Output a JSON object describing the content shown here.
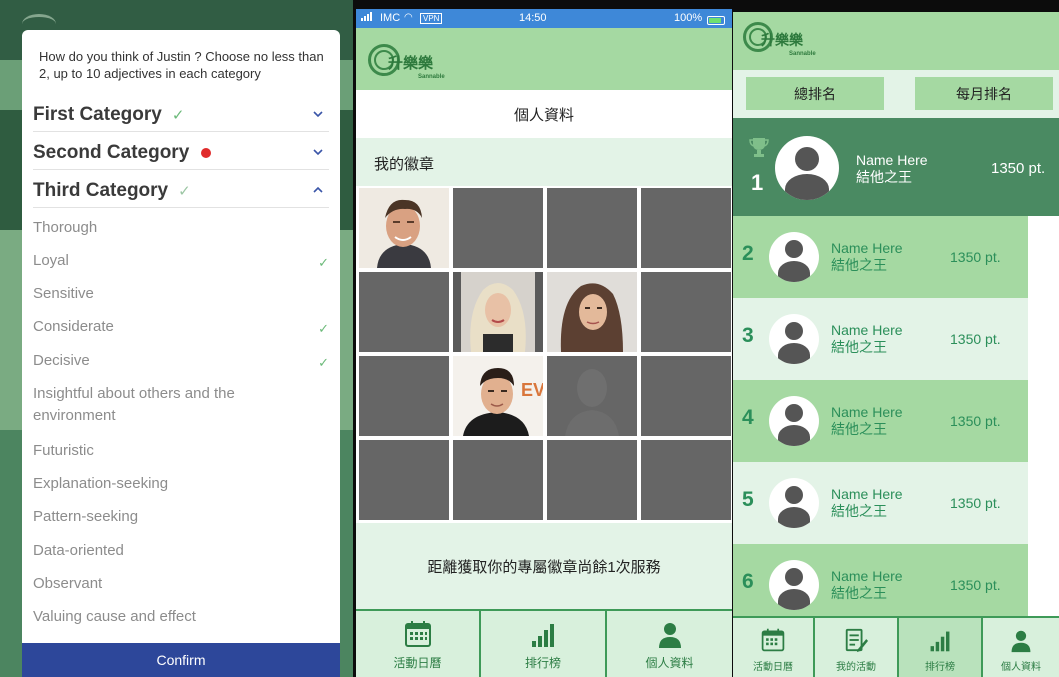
{
  "panel1": {
    "question": "How do you think of Justin ? Choose no less than 2, up to 10 adjectives in each category",
    "categories": [
      {
        "title": "First Category",
        "status": "check"
      },
      {
        "title": "Second Category",
        "status": "error"
      },
      {
        "title": "Third Category",
        "status": "check"
      }
    ],
    "adjectives": [
      {
        "label": "Thorough",
        "selected": false
      },
      {
        "label": "Loyal",
        "selected": true
      },
      {
        "label": "Sensitive",
        "selected": false
      },
      {
        "label": "Considerate",
        "selected": true
      },
      {
        "label": "Decisive",
        "selected": true
      },
      {
        "label": "Insightful about others and the environment",
        "selected": false
      },
      {
        "label": "Futuristic",
        "selected": false
      },
      {
        "label": "Explanation-seeking",
        "selected": false
      },
      {
        "label": "Pattern-seeking",
        "selected": false
      },
      {
        "label": "Data-oriented",
        "selected": false
      },
      {
        "label": "Observant",
        "selected": false
      },
      {
        "label": "Valuing cause and effect",
        "selected": false
      }
    ],
    "confirm_label": "Confirm",
    "check_glyph": "✓",
    "colors": {
      "accent_green": "#6cba7a",
      "error_red": "#e02b2b",
      "confirm_blue": "#2d479a"
    }
  },
  "panel2": {
    "status": {
      "carrier": "IMC",
      "vpn": "VPN",
      "time": "14:50",
      "battery": "100%"
    },
    "logo_text": "升樂樂",
    "logo_sub": "Sannable",
    "title": "個人資料",
    "badges_heading": "我的徽章",
    "message": "距離獲取你的專屬徽章尚餘1次服務",
    "nav": [
      {
        "label": "活動日曆",
        "icon": "calendar-icon"
      },
      {
        "label": "排行榜",
        "icon": "bar-chart-icon"
      },
      {
        "label": "個人資料",
        "icon": "person-icon"
      }
    ],
    "colors": {
      "header_green": "#a5d9a2",
      "light_green": "#e3f3e7",
      "status_blue": "#3e88d8"
    }
  },
  "panel3": {
    "logo_text": "升樂樂",
    "logo_sub": "Sannable",
    "tabs": [
      "總排名",
      "每月排名"
    ],
    "rankings": [
      {
        "rank": "1",
        "name": "Name Here",
        "title": "結他之王",
        "points": "1350 pt."
      },
      {
        "rank": "2",
        "name": "Name Here",
        "title": "結他之王",
        "points": "1350 pt."
      },
      {
        "rank": "3",
        "name": "Name Here",
        "title": "結他之王",
        "points": "1350 pt."
      },
      {
        "rank": "4",
        "name": "Name Here",
        "title": "結他之王",
        "points": "1350 pt."
      },
      {
        "rank": "5",
        "name": "Name Here",
        "title": "結他之王",
        "points": "1350 pt."
      },
      {
        "rank": "6",
        "name": "Name Here",
        "title": "結他之王",
        "points": "1350 pt."
      }
    ],
    "nav": [
      {
        "label": "活動日曆",
        "icon": "calendar-icon"
      },
      {
        "label": "我的活動",
        "icon": "edit-list-icon"
      },
      {
        "label": "排行榜",
        "icon": "bar-chart-icon"
      },
      {
        "label": "個人資料",
        "icon": "person-icon"
      }
    ],
    "colors": {
      "top_rank_bg": "#4a8a62",
      "rank_green": "#a5d9a2",
      "rank_light": "#e3f3e7"
    }
  }
}
